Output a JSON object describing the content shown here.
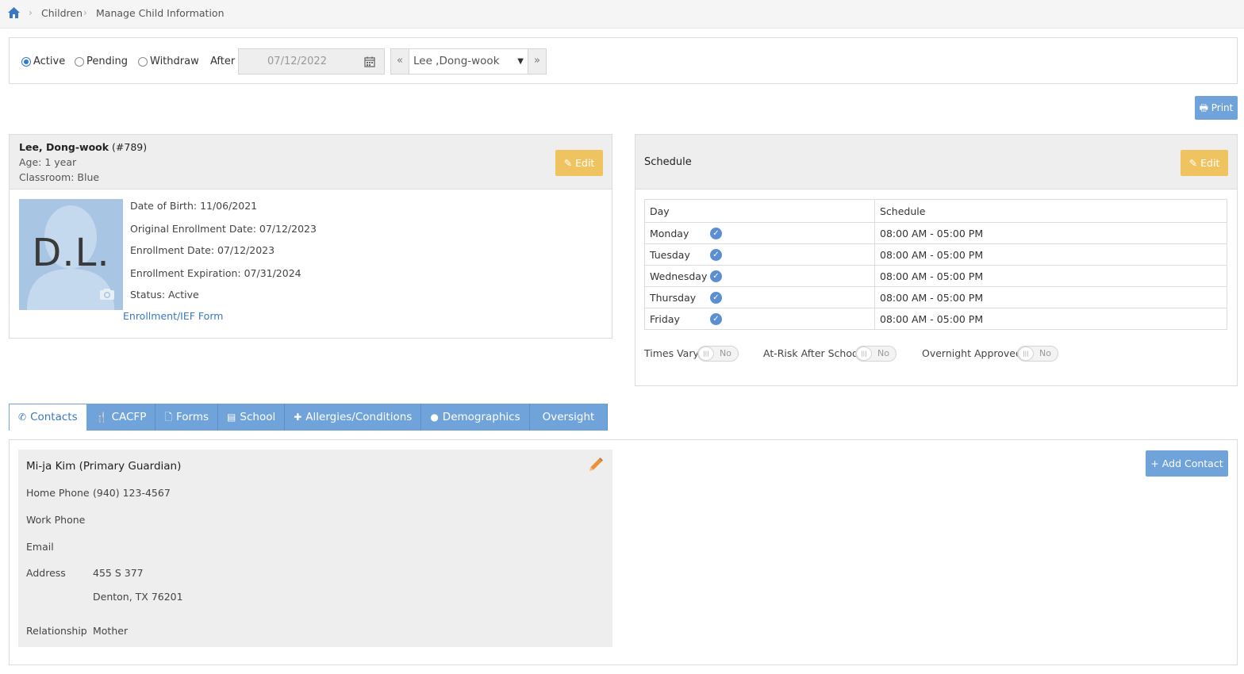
{
  "breadcrumb": {
    "items": [
      "Children",
      "Manage Child Information"
    ]
  },
  "filter": {
    "statuses": [
      {
        "label": "Active",
        "selected": true
      },
      {
        "label": "Pending",
        "selected": false
      },
      {
        "label": "Withdraw",
        "selected": false
      }
    ],
    "after_label": "After",
    "after_date": "07/12/2022",
    "child_selected": "Lee ,Dong-wook",
    "prev_glyph": "«",
    "next_glyph": "»"
  },
  "print_button": "Print",
  "child": {
    "name": "Lee, Dong-wook",
    "id": "(#789)",
    "age": "Age: 1 year",
    "classroom": "Classroom: Blue",
    "edit_label": "Edit",
    "initials": "D.L.",
    "details": [
      "Date of Birth: 11/06/2021",
      "Original Enrollment Date: 07/12/2023",
      "Enrollment Date: 07/12/2023",
      "Enrollment Expiration: 07/31/2024",
      "Status: Active"
    ],
    "form_link": "Enrollment/IEF Form"
  },
  "schedule": {
    "title": "Schedule",
    "edit_label": "Edit",
    "columns": [
      "Day",
      "Schedule"
    ],
    "rows": [
      {
        "day": "Monday",
        "time": "08:00 AM - 05:00 PM"
      },
      {
        "day": "Tuesday",
        "time": "08:00 AM - 05:00 PM"
      },
      {
        "day": "Wednesday",
        "time": "08:00 AM - 05:00 PM"
      },
      {
        "day": "Thursday",
        "time": "08:00 AM - 05:00 PM"
      },
      {
        "day": "Friday",
        "time": "08:00 AM - 05:00 PM"
      }
    ],
    "toggles": [
      {
        "label": "Times Vary",
        "value": "No"
      },
      {
        "label": "At-Risk After School",
        "value": "No"
      },
      {
        "label": "Overnight Approved",
        "value": "No"
      }
    ]
  },
  "tabs": [
    {
      "label": "Contacts",
      "icon": "phone-icon",
      "active": true
    },
    {
      "label": "CACFP",
      "icon": "utensils-icon",
      "active": false
    },
    {
      "label": "Forms",
      "icon": "file-icon",
      "active": false
    },
    {
      "label": "School",
      "icon": "building-icon",
      "active": false
    },
    {
      "label": "Allergies/Conditions",
      "icon": "medkit-icon",
      "active": false
    },
    {
      "label": "Demographics",
      "icon": "globe-icon",
      "active": false
    },
    {
      "label": "Oversight",
      "icon": "",
      "active": false
    }
  ],
  "contact": {
    "title": "Mi-ja Kim (Primary Guardian)",
    "home_phone_label": "Home Phone",
    "home_phone": "(940) 123-4567",
    "work_phone_label": "Work Phone",
    "work_phone": "",
    "email_label": "Email",
    "email": "",
    "address_label": "Address",
    "address_line1": "455 S 377",
    "address_line2": "Denton, TX 76201",
    "relationship_label": "Relationship",
    "relationship": "Mother"
  },
  "add_contact_button": "+ Add Contact",
  "colors": {
    "primary": "#6fa3da",
    "warning": "#f0c361",
    "link": "#3a78c4"
  }
}
